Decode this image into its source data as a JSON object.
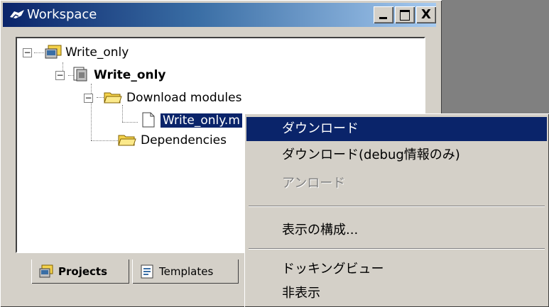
{
  "window": {
    "title": "Workspace",
    "minimize_label": "_",
    "maximize_label": "□",
    "close_label": "X"
  },
  "tree": {
    "root": {
      "label": "Write_only",
      "expander": "−"
    },
    "project": {
      "label": "Write_only",
      "expander": "−"
    },
    "download_modules": {
      "label": "Download modules",
      "expander": "−"
    },
    "module_file": {
      "label": "Write_only.m"
    },
    "dependencies": {
      "label": "Dependencies"
    }
  },
  "tabs": [
    {
      "label": "Projects",
      "icon": "projects-icon",
      "active": true
    },
    {
      "label": "Templates",
      "icon": "templates-icon",
      "active": false
    }
  ],
  "context_menu": {
    "items": [
      {
        "label": "ダウンロード",
        "state": "highlighted"
      },
      {
        "label": "ダウンロード(debug情報のみ)",
        "state": "normal"
      },
      {
        "label": "アンロード",
        "state": "disabled"
      },
      {
        "label": "表示の構成...",
        "state": "normal"
      },
      {
        "label": "ドッキングビュー",
        "state": "normal"
      },
      {
        "label": "非表示",
        "state": "normal"
      }
    ]
  },
  "colors": {
    "title_gradient_start": "#0a246a",
    "title_gradient_end": "#a6caf0",
    "selection": "#0a246a",
    "face": "#d4d0c8",
    "folder": "#f5d34c"
  }
}
